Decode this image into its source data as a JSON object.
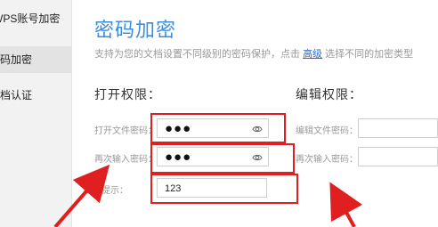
{
  "sidebar": {
    "items": [
      {
        "label": "WPS账号加密",
        "active": false
      },
      {
        "label": "密码加密",
        "active": true
      },
      {
        "label": "文档认证",
        "active": false
      }
    ]
  },
  "main": {
    "title": "密码加密",
    "description_prefix": "支持为您的文档设置不同级别的密码保护，点击",
    "advanced_link": "高级",
    "description_suffix": "选择不同的加密类型"
  },
  "open_permission": {
    "heading": "打开权限：",
    "file_password_label": "打开文件密码：",
    "file_password_value": "●●●",
    "confirm_label": "再次输入密码：",
    "confirm_value": "●●●",
    "hint_label": "密码提示：",
    "hint_value": "123"
  },
  "edit_permission": {
    "heading": "编辑权限：",
    "file_password_label": "编辑文件密码：",
    "confirm_label": "再次输入密码："
  },
  "colors": {
    "accent": "#3c8dde",
    "annotation": "#e02020"
  },
  "icons": [
    "eye-icon",
    "arrow-annotation"
  ]
}
